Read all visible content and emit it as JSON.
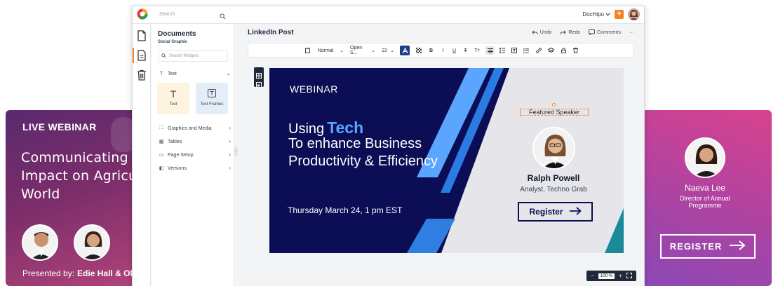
{
  "topbar": {
    "search_placeholder": "Search",
    "brand": "DocHipo",
    "plus_label": "+"
  },
  "panel": {
    "title": "Documents",
    "subtitle": "Social Graphic",
    "search_placeholder": "Search Widgets",
    "text_section": "Text",
    "tile_text": "Text",
    "tile_frames": "Text Frames",
    "sections": [
      "Graphics and Media",
      "Tables",
      "Page Setup",
      "Versions"
    ]
  },
  "doc": {
    "title": "LinkedIn Post",
    "undo": "Undo",
    "redo": "Redo",
    "comments": "Comments",
    "more": "···"
  },
  "toolbar": {
    "style": "Normal",
    "font": "Open S...",
    "size": "22",
    "bold": "B",
    "italic": "I",
    "underline": "U",
    "strike": "T",
    "case": "Tт"
  },
  "banner": {
    "webinar": "WEBINAR",
    "using": "Using",
    "tech": "Tech",
    "line2": "To enhance Business Productivity & Efficiency",
    "date": "Thursday March 24, 1 pm EST",
    "featured": "Featured Speaker",
    "speaker_name": "Ralph Powell",
    "speaker_role": "Analyst, Techno Grab",
    "register": "Register"
  },
  "zoom": {
    "value": "100 %",
    "minus": "−",
    "plus": "+"
  },
  "bg_left": {
    "live": "LIVE WEBINAR",
    "title": "Communicating Climate Impact on Agriculture World",
    "presented_by": "Presented by:",
    "presenters": "Edie Hall & Oli"
  },
  "bg_right": {
    "name": "Naeva Lee",
    "role": "Director of Annual Programme",
    "register": "REGISTER"
  },
  "colors": {
    "accent": "#f58220",
    "navy": "#0b0d55",
    "tech_blue": "#58a6ff",
    "stripe_blue": "#2b7be4"
  }
}
